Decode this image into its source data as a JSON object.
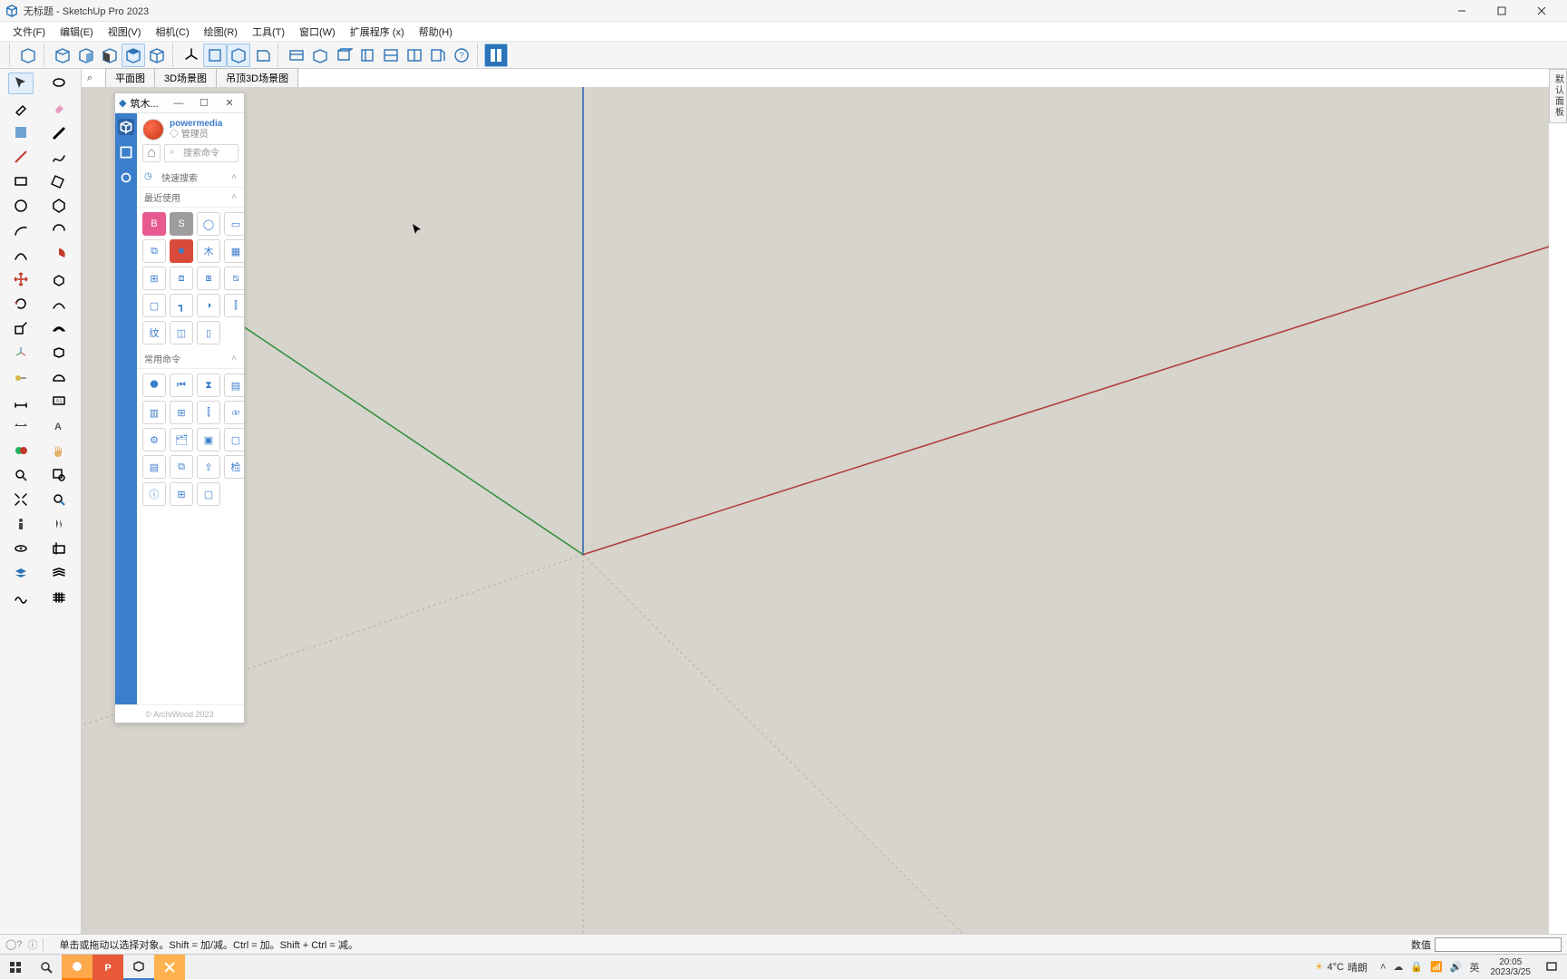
{
  "window": {
    "title": "无标题 - SketchUp Pro 2023"
  },
  "menu": [
    "文件(F)",
    "编辑(E)",
    "视图(V)",
    "相机(C)",
    "绘图(R)",
    "工具(T)",
    "窗口(W)",
    "扩展程序 (x)",
    "帮助(H)"
  ],
  "scene_tabs": [
    "平面图",
    "3D场景图",
    "吊顶3D场景图"
  ],
  "right_tray_label": "默认面板",
  "status": {
    "hint": "单击或拖动以选择对象。Shift = 加/减。Ctrl = 加。Shift + Ctrl = 减。",
    "measure_label": "数值"
  },
  "plugin": {
    "title": "筑木...",
    "user_name": "powermedia",
    "user_role": "管理员",
    "search_placeholder": "搜索命令",
    "section_quick": "快速搜索",
    "section_recent": "最近使用",
    "section_common": "常用命令",
    "footer": "© ArchiWood 2023",
    "recent_cells": [
      "B",
      "S",
      "◯",
      "▭",
      "⧉",
      "■",
      "木",
      "▦",
      "⊞",
      "⧈",
      "⧆",
      "⧅",
      "▢",
      "┓",
      "◑",
      "⫿",
      "纹",
      "◫",
      "▯",
      ""
    ],
    "common_cells": [
      "⯃",
      "⏮",
      "⧗",
      "▤",
      "▥",
      "⊞",
      "⫿",
      "⧞",
      "⚙",
      "🗂",
      "▣",
      "▢",
      "▤",
      "⧉",
      "⇪",
      "检",
      "ⓘ",
      "⊞",
      "▢",
      ""
    ]
  },
  "taskbar": {
    "weather_temp": "4°C",
    "weather_text": "晴朗",
    "ime": "英",
    "time": "20:05",
    "date": "2023/3/25"
  }
}
